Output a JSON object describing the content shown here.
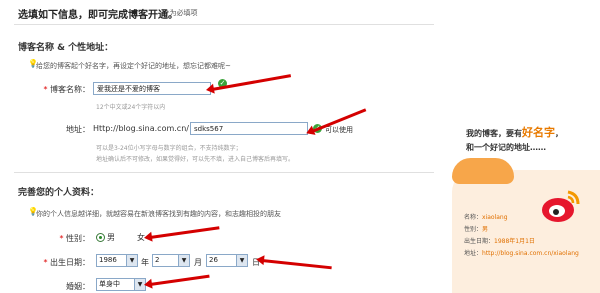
{
  "header": {
    "title": "选填如下信息，即可完成博客开通。",
    "required_note": "*为必填项"
  },
  "section_blog": {
    "title": "博客名称 & 个性地址：",
    "tip": "给您的博客起个好名字，再设定个好记的地址，想忘记都难呢~",
    "name_label": "博客名称：",
    "name_value": "爱我还是不爱的博客",
    "name_hint": "12个中文或24个字符以内",
    "address_label": "地址：",
    "address_prefix": "Http://blog.sina.com.cn/",
    "address_value": "sdks567",
    "address_status": "可以使用",
    "address_hint_1": "可以是3-24位小写字母与数字的组合，不支持纯数字；",
    "address_hint_2": "地址确认后不可修改，如果觉得好，可以先不填，进入自己博客后再填写。"
  },
  "section_personal": {
    "title": "完善您的个人资料：",
    "tip": "你的个人信息越详细，就越容易在新浪博客找到有趣的内容，和志趣相投的朋友",
    "gender_label": "性别：",
    "gender_male": "男",
    "gender_female": "女",
    "birthday_label": "出生日期：",
    "birth_year": "1986",
    "year_unit": "年",
    "birth_month": "2",
    "month_unit": "月",
    "birth_day": "26",
    "day_unit": "日",
    "marital_label": "婚姻：",
    "marital_value": "单身中"
  },
  "promo": {
    "line1_a": "我的博客，要有",
    "line1_b": "好名字",
    "line1_c": "，",
    "line2": "和一个好记的地址……"
  },
  "card": {
    "name_label": "名称：",
    "name_value": "xiaolang",
    "gender_label": "性别：",
    "gender_value": "男",
    "birth_label": "出生日期：",
    "birth_value": "1988年1月1日",
    "addr_label": "地址：",
    "addr_value": "http://blog.sina.com.cn/xiaolang"
  },
  "colors": {
    "arrow": "#d40000",
    "accent": "#e87a00",
    "required": "#dd0000"
  }
}
